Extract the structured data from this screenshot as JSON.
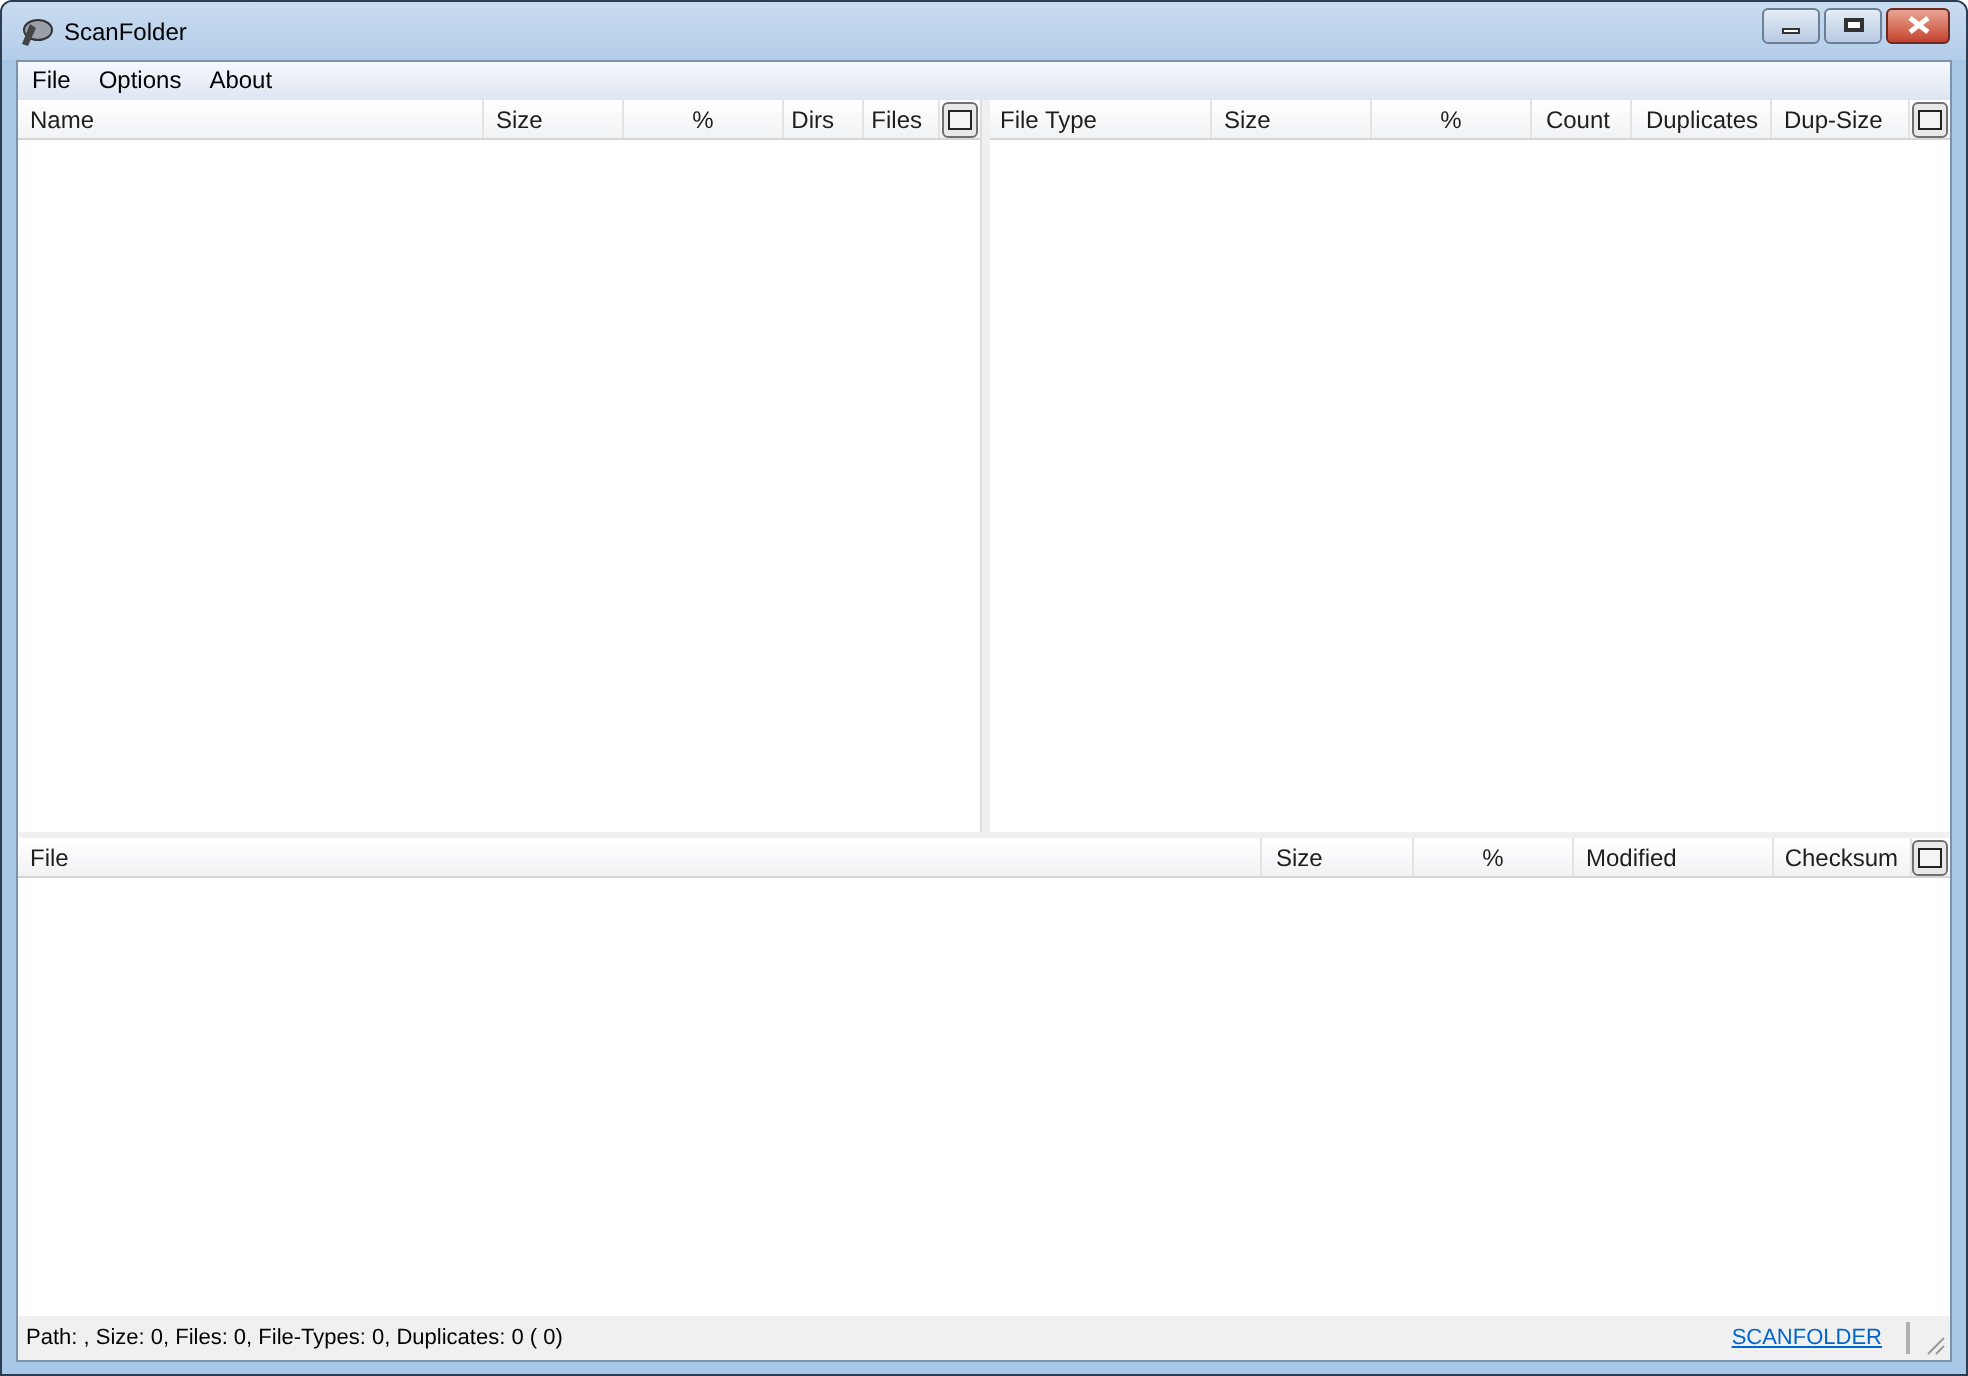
{
  "window": {
    "title": "ScanFolder"
  },
  "menu": [
    "File",
    "Options",
    "About"
  ],
  "folders_table": {
    "columns": [
      "Name",
      "Size",
      "%",
      "Dirs",
      "Files"
    ]
  },
  "file_types_table": {
    "columns": [
      "File Type",
      "Size",
      "%",
      "Count",
      "Duplicates",
      "Dup-Size"
    ]
  },
  "files_table": {
    "columns": [
      "File",
      "Size",
      "%",
      "Modified",
      "Checksum"
    ]
  },
  "status_bar": {
    "text": "Path: , Size: 0, Files: 0, File-Types: 0, Duplicates: 0 ( 0)",
    "link": "SCANFOLDER"
  }
}
